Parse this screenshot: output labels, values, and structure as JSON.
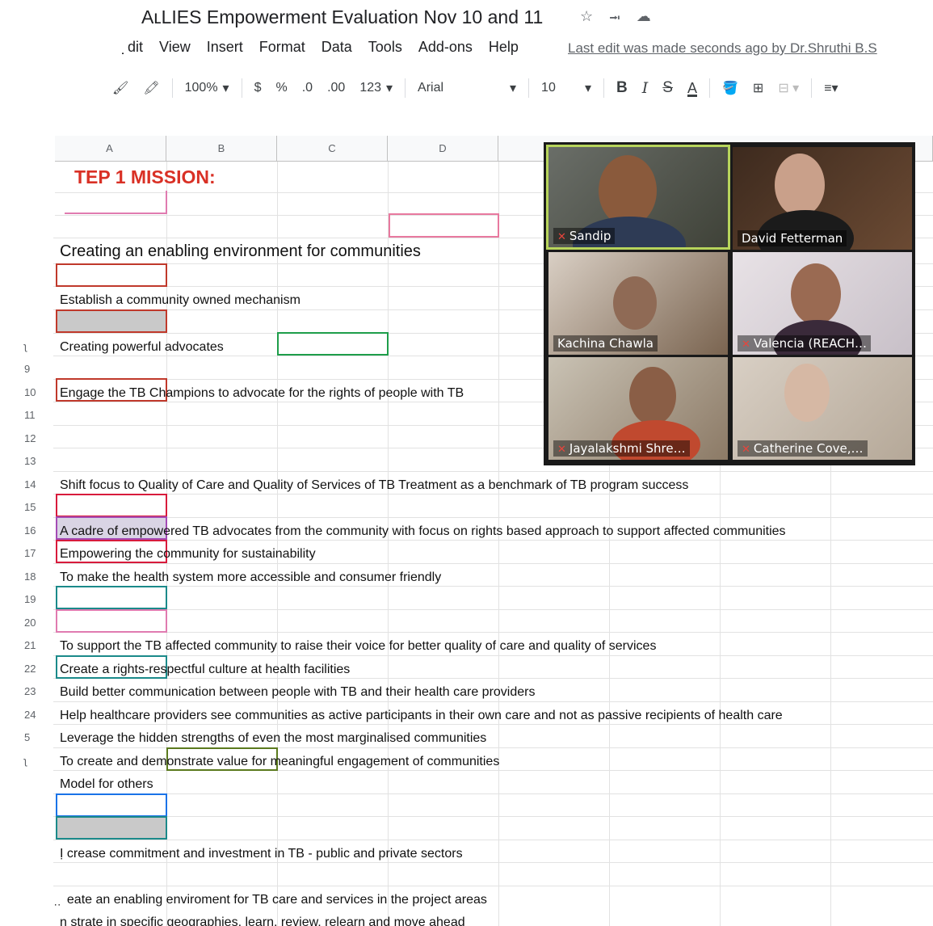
{
  "doc_title": "AʟLIES Empowerment Evaluation Nov 10 and 11",
  "title_icons": [
    "☆",
    "⭲",
    "☁"
  ],
  "menu": [
    "̣̣̣dit",
    "View",
    "Insert",
    "Format",
    "Data",
    "Tools",
    "Add-ons",
    "Help"
  ],
  "last_edit": "Last edit was made seconds ago by Dr.Shruthi B.S",
  "toolbar": {
    "zoom": "100%",
    "currency": "$",
    "percent": "%",
    "dec_less": ".0",
    "dec_more": ".00",
    "number_format": "123",
    "font": "Arial",
    "font_size": "10",
    "bold": "B",
    "italic": "I",
    "strike": "S",
    "text_color": "A"
  },
  "columns": [
    "A",
    "B",
    "C",
    "D"
  ],
  "mission_heading": "ТEP 1 MISSION:",
  "rows": [
    {
      "num": "",
      "text": "Creating an enabling environment for communities",
      "big": true
    },
    {
      "num": "",
      "text": "Establish a community owned mechanism"
    },
    {
      "num": "ʅ",
      "text": "Creating powerful advocates"
    },
    {
      "num": "9",
      "text": ""
    },
    {
      "num": "10",
      "text": "Engage the TB Champions to advocate for the rights of people with TB"
    },
    {
      "num": "11",
      "text": ""
    },
    {
      "num": "12",
      "text": ""
    },
    {
      "num": "13",
      "text": ""
    },
    {
      "num": "14",
      "text": "Shift focus to Quality of Care and Quality of Services of TB Treatment as a benchmark of TB program success"
    },
    {
      "num": "15",
      "text": ""
    },
    {
      "num": "16",
      "text": "A cadre of empowered TB advocates from the community with focus on rights based approach to support affected communities"
    },
    {
      "num": "17",
      "text": "Empowering the community for sustainability"
    },
    {
      "num": "18",
      "text": "To make the health system more accessible and consumer friendly"
    },
    {
      "num": "19",
      "text": ""
    },
    {
      "num": "20",
      "text": ""
    },
    {
      "num": "21",
      "text": "To support the TB affected community to raise their voice for better quality of care and quality of services"
    },
    {
      "num": "22",
      "text": "Create a rights-respectful culture at health facilities"
    },
    {
      "num": "23",
      "text": "Build better communication between people with TB and their health care providers"
    },
    {
      "num": "24",
      "text": "Help healthcare providers see communities as active participants in their own care and not as passive recipients of health care"
    },
    {
      "num": "5",
      "text": "Leverage the hidden strengths of even the most marginalised communities"
    },
    {
      "num": "ʅ",
      "text": "To create and demonstrate value for meaningful engagement of communities"
    },
    {
      "num": "",
      "text": "Model for others"
    },
    {
      "num": "",
      "text": "Ị crease commitment and investment in TB - public and private sectors"
    },
    {
      "num": "",
      "text": "̣ ̣ eate an enabling enviroment for TB care and services in the project areas"
    },
    {
      "num": "",
      "text": "̣ṇ ̣strate in specific geographies, learn, review, relearn and move ahead"
    }
  ],
  "participants": [
    {
      "name": "Sandip",
      "muted": true,
      "active": true
    },
    {
      "name": "David Fetterman",
      "muted": false,
      "active": false
    },
    {
      "name": "Kachina Chawla",
      "muted": false,
      "active": false
    },
    {
      "name": "Valencia (REACH…",
      "muted": true,
      "active": false
    },
    {
      "name": "Jayalakshmi Shre…",
      "muted": true,
      "active": false
    },
    {
      "name": "Catherine Cove,…",
      "muted": true,
      "active": false
    }
  ]
}
